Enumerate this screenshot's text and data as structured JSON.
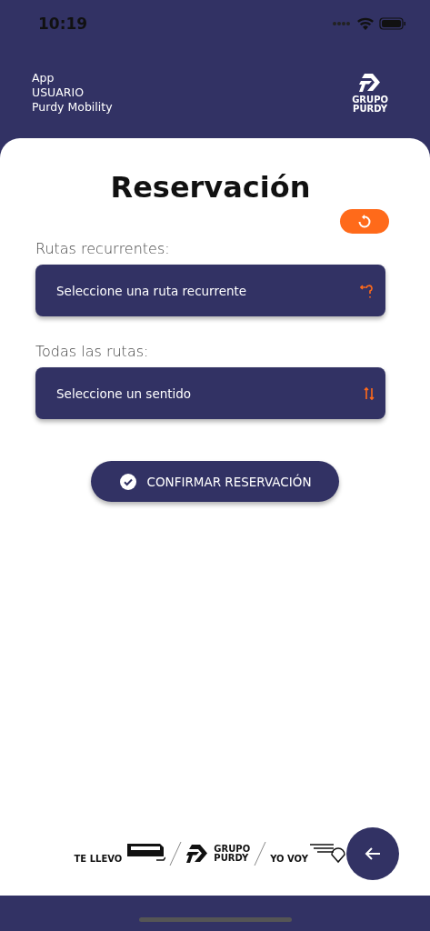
{
  "status_bar": {
    "time": "10:19"
  },
  "header": {
    "lines": [
      "App",
      "USUARIO",
      "Purdy Mobility"
    ],
    "logo": [
      "GRUPO",
      "PURDY"
    ]
  },
  "title": "Reservación",
  "fields": [
    {
      "kind": "recurrent",
      "label": "Rutas recurrentes:",
      "placeholder": "Seleccione una ruta recurrente"
    },
    {
      "kind": "direction",
      "label": "Todas las rutas:",
      "placeholder": "Seleccione un sentido"
    }
  ],
  "confirm_button": "CONFIRMAR RESERVACIÓN",
  "footer_brands": [
    {
      "kind": "bus",
      "lines": [
        "TE LLEVO"
      ]
    },
    {
      "kind": "purdy",
      "lines": [
        "GRUPO",
        "PURDY"
      ]
    },
    {
      "kind": "wings",
      "lines": [
        "YO VOY"
      ]
    }
  ]
}
